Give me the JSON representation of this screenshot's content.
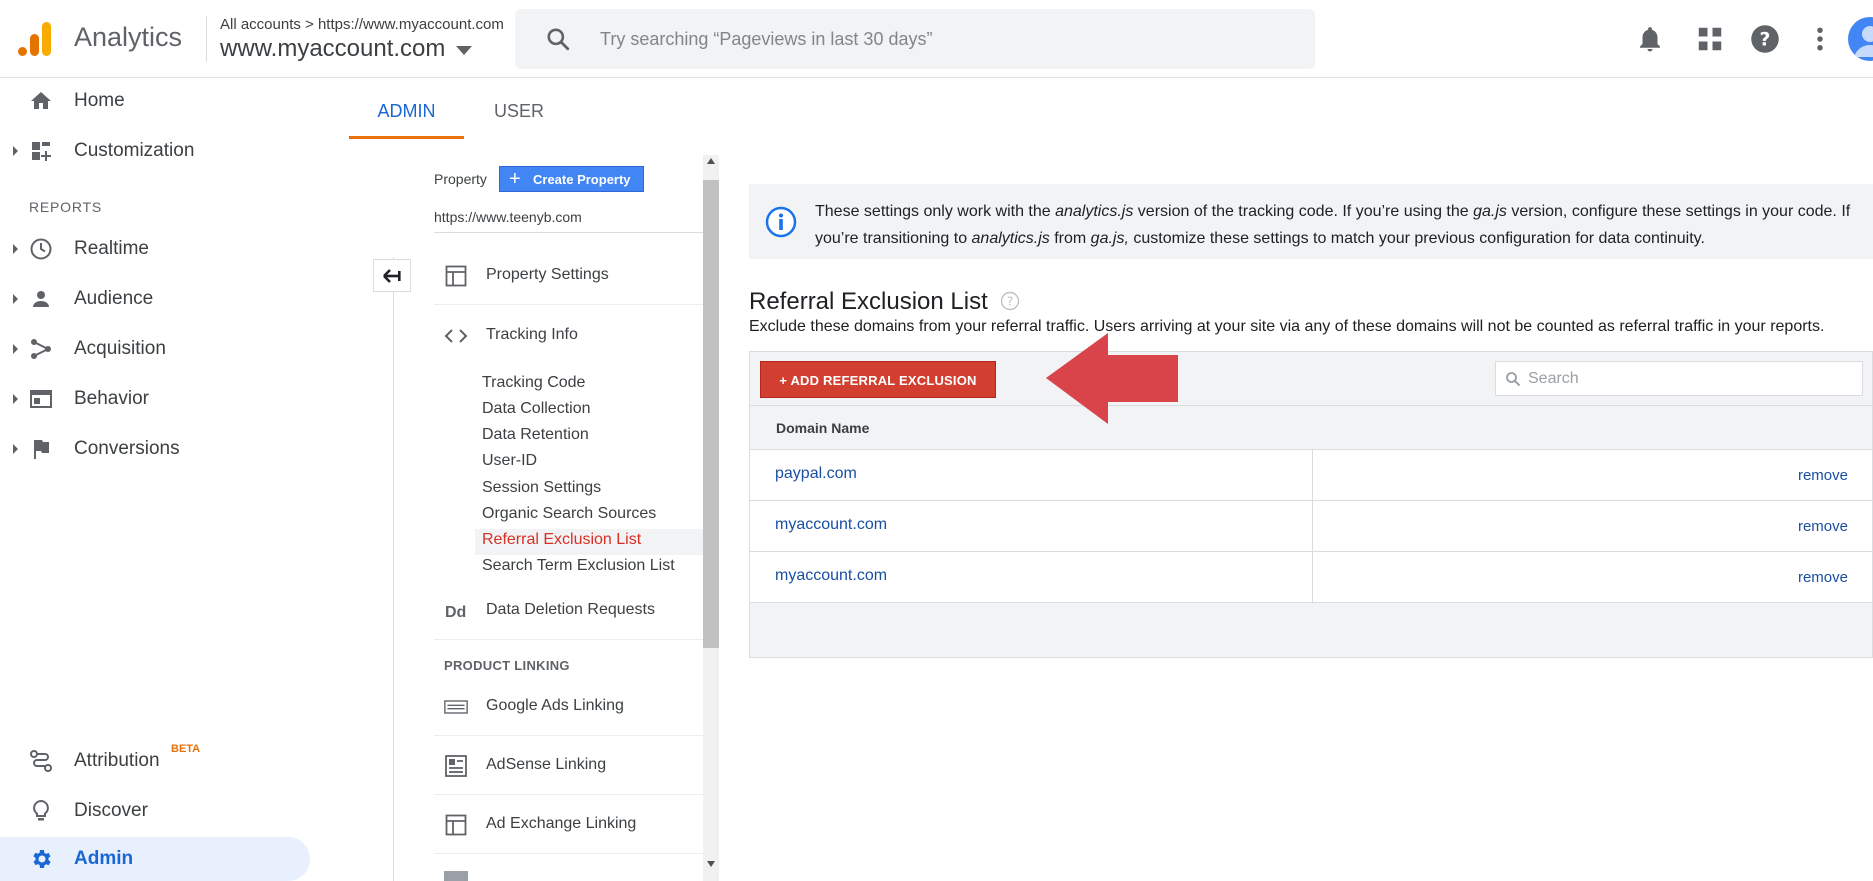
{
  "header": {
    "app_title": "Analytics",
    "breadcrumb": "All accounts > https://www.myaccount.com",
    "account_name": "www.myaccount.com",
    "search_placeholder": "Try searching “Pageviews in last 30 days”",
    "icons": [
      "analytics-logo-icon",
      "search-icon",
      "bell-icon",
      "apps-grid-icon",
      "help-icon",
      "more-vert-icon",
      "avatar"
    ]
  },
  "sidebar": {
    "items": [
      {
        "label": "Home",
        "icon": "home-icon"
      },
      {
        "label": "Customization",
        "icon": "customization-icon"
      },
      {
        "label": "Realtime",
        "icon": "clock-icon"
      },
      {
        "label": "Audience",
        "icon": "person-icon"
      },
      {
        "label": "Acquisition",
        "icon": "acquisition-icon"
      },
      {
        "label": "Behavior",
        "icon": "behavior-icon"
      },
      {
        "label": "Conversions",
        "icon": "flag-icon"
      }
    ],
    "reports_heading": "REPORTS",
    "bottom_items": [
      {
        "label": "Attribution",
        "icon": "attribution-icon",
        "badge": "BETA"
      },
      {
        "label": "Discover",
        "icon": "lightbulb-icon"
      },
      {
        "label": "Admin",
        "icon": "gear-icon"
      }
    ]
  },
  "admin_tabs": [
    "ADMIN",
    "USER"
  ],
  "property_column": {
    "label": "Property",
    "create_button": "Create Property",
    "property_url": "https://www.teenyb.com",
    "items": [
      {
        "label": "Property Settings",
        "icon": "property-settings-icon"
      },
      {
        "label": "Tracking Info",
        "icon": "code-brackets-icon"
      }
    ],
    "tracking_sub_items": [
      "Tracking Code",
      "Data Collection",
      "Data Retention",
      "User-ID",
      "Session Settings",
      "Organic Search Sources",
      "Referral Exclusion List",
      "Search Term Exclusion List"
    ],
    "active_sub_item": "Referral Exclusion List",
    "data_deletion": {
      "label": "Data Deletion Requests",
      "icon_text": "Dd"
    },
    "product_linking_heading": "PRODUCT LINKING",
    "linking_items": [
      {
        "label": "Google Ads Linking",
        "icon": "google-ads-icon"
      },
      {
        "label": "AdSense Linking",
        "icon": "adsense-icon"
      },
      {
        "label": "Ad Exchange Linking",
        "icon": "ad-exchange-icon"
      }
    ]
  },
  "main": {
    "info_banner": {
      "t1": "These settings only work with the ",
      "em1": "analytics.js",
      "t2": " version of the tracking code. If you’re using the ",
      "em2": "ga.js",
      "t3": " version, configure these settings in your code. If you’re transitioning to ",
      "em3": "analytics.js",
      "t4": " from ",
      "em4": "ga.js,",
      "t5": " customize these settings to match your previous configuration for data continuity."
    },
    "heading": "Referral Exclusion List",
    "description": "Exclude these domains from your referral traffic. Users arriving at your site via any of these domains will not be counted as referral traffic in your reports.",
    "add_button": "+ ADD REFERRAL EXCLUSION",
    "search_placeholder": "Search",
    "column_header": "Domain Name",
    "rows": [
      {
        "domain": "paypal.com",
        "action": "remove"
      },
      {
        "domain": "myaccount.com",
        "action": "remove"
      },
      {
        "domain": "myaccount.com",
        "action": "remove"
      }
    ]
  },
  "colors": {
    "accent_blue": "#1967d2",
    "tab_underline_orange": "#e8710a",
    "add_button_red": "#d23f31",
    "annotation_arrow_red": "#d9434a",
    "link_blue": "#1a4fa3"
  }
}
